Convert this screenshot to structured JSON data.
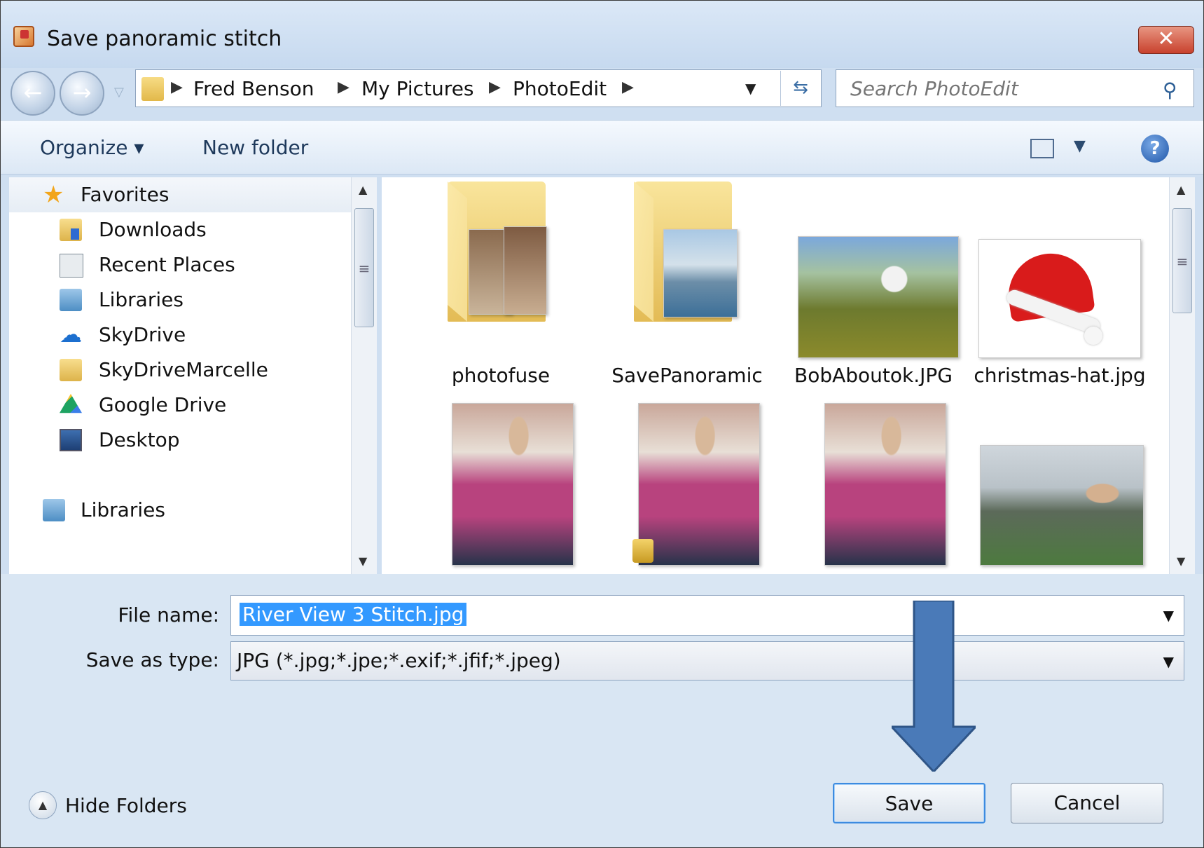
{
  "window": {
    "title": "Save panoramic stitch",
    "close_label": "✕"
  },
  "address": {
    "crumbs": [
      "Fred Benson",
      "My Pictures",
      "PhotoEdit"
    ]
  },
  "search": {
    "placeholder": "Search PhotoEdit"
  },
  "toolbar": {
    "organize_label": "Organize ▾",
    "new_folder_label": "New folder"
  },
  "sidebar": {
    "favorites_label": "Favorites",
    "items": [
      {
        "label": "Downloads",
        "icon": "downloads-folder-icon"
      },
      {
        "label": "Recent Places",
        "icon": "recent-places-icon"
      },
      {
        "label": "Libraries",
        "icon": "libraries-icon"
      },
      {
        "label": "SkyDrive",
        "icon": "skydrive-icon"
      },
      {
        "label": "SkyDriveMarcelle",
        "icon": "folder-icon"
      },
      {
        "label": "Google Drive",
        "icon": "google-drive-icon"
      },
      {
        "label": "Desktop",
        "icon": "desktop-icon"
      }
    ],
    "libraries_label": "Libraries"
  },
  "files": [
    {
      "label": "photofuse",
      "type": "folder"
    },
    {
      "label": "SavePanoramic",
      "type": "folder"
    },
    {
      "label": "BobAboutok.JPG",
      "type": "image"
    },
    {
      "label": "christmas-hat.jpg",
      "type": "image"
    }
  ],
  "form": {
    "file_name_label": "File name:",
    "file_name_value": "River View 3 Stitch.jpg",
    "save_type_label": "Save as type:",
    "save_type_value": "JPG (*.jpg;*.jpe;*.exif;*.jfif;*.jpeg)"
  },
  "footer": {
    "hide_folders_label": "Hide Folders",
    "save_label": "Save",
    "cancel_label": "Cancel"
  },
  "colors": {
    "accent": "#3399ff",
    "annotation_arrow": "#4a7ab8"
  }
}
